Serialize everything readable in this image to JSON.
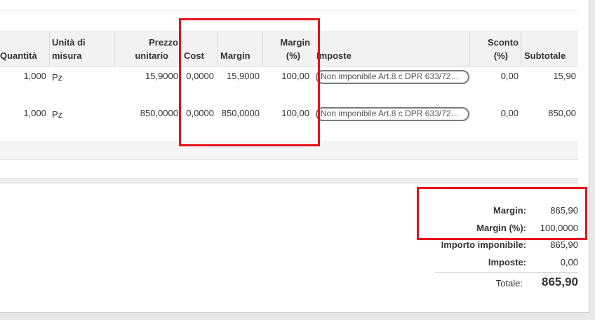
{
  "table": {
    "headers": {
      "quantity": "Quantità",
      "uom_line1": "Unità di",
      "uom_line2": "misura",
      "price_line1": "Prezzo",
      "price_line2": "unitario",
      "cost": "Cost",
      "margin": "Margin",
      "margin_pct_line1": "Margin",
      "margin_pct_line2": "(%)",
      "taxes": "Imposte",
      "discount_line1": "Sconto",
      "discount_line2": "(%)",
      "subtotal": "Subtotale"
    },
    "rows": [
      {
        "quantity": "1,000",
        "uom": "Pz",
        "price": "15,9000",
        "cost": "0,0000",
        "margin": "15,9000",
        "margin_pct": "100,00",
        "taxes": "Non imponibile Art.8 c DPR 633/72…",
        "discount": "0,00",
        "subtotal": "15,90"
      },
      {
        "quantity": "1,000",
        "uom": "Pz",
        "price": "850,0000",
        "cost": "0,0000",
        "margin": "850,0000",
        "margin_pct": "100,00",
        "taxes": "Non imponibile Art.8 c DPR 633/72…",
        "discount": "0,00",
        "subtotal": "850,00"
      }
    ]
  },
  "totals": {
    "margin_label": "Margin:",
    "margin_value": "865,90",
    "margin_pct_label": "Margin (%):",
    "margin_pct_value": "100,0000",
    "untaxed_label": "Importo imponibile:",
    "untaxed_value": "865,90",
    "taxes_label": "Imposte:",
    "taxes_value": "0,00",
    "total_label": "Totale:",
    "total_value": "865,90"
  },
  "colors": {
    "highlight": "#e8101b"
  }
}
